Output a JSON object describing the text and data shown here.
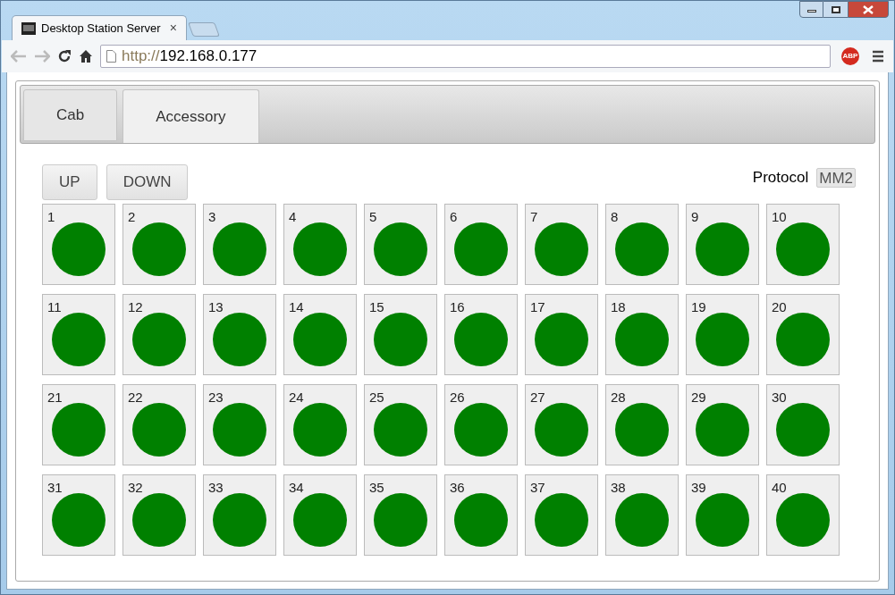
{
  "window": {
    "title": "Desktop Station Server",
    "close_tab": "×"
  },
  "address_bar": {
    "scheme": "http://",
    "host": "192.168.0.177"
  },
  "extension": {
    "label": "ABP"
  },
  "tabs": [
    {
      "label": "Cab",
      "selected": false
    },
    {
      "label": "Accessory",
      "selected": true
    }
  ],
  "buttons": [
    "UP",
    "DOWN"
  ],
  "protocol": {
    "label": "Protocol",
    "value": "MM2"
  },
  "accessories": [
    {
      "number": "1",
      "on": true
    },
    {
      "number": "2",
      "on": true
    },
    {
      "number": "3",
      "on": true
    },
    {
      "number": "4",
      "on": true
    },
    {
      "number": "5",
      "on": true
    },
    {
      "number": "6",
      "on": true
    },
    {
      "number": "7",
      "on": true
    },
    {
      "number": "8",
      "on": true
    },
    {
      "number": "9",
      "on": true
    },
    {
      "number": "10",
      "on": true
    },
    {
      "number": "11",
      "on": true
    },
    {
      "number": "12",
      "on": true
    },
    {
      "number": "13",
      "on": true
    },
    {
      "number": "14",
      "on": true
    },
    {
      "number": "15",
      "on": true
    },
    {
      "number": "16",
      "on": true
    },
    {
      "number": "17",
      "on": true
    },
    {
      "number": "18",
      "on": true
    },
    {
      "number": "19",
      "on": true
    },
    {
      "number": "20",
      "on": true
    },
    {
      "number": "21",
      "on": true
    },
    {
      "number": "22",
      "on": true
    },
    {
      "number": "23",
      "on": true
    },
    {
      "number": "24",
      "on": true
    },
    {
      "number": "25",
      "on": true
    },
    {
      "number": "26",
      "on": true
    },
    {
      "number": "27",
      "on": true
    },
    {
      "number": "28",
      "on": true
    },
    {
      "number": "29",
      "on": true
    },
    {
      "number": "30",
      "on": true
    },
    {
      "number": "31",
      "on": true
    },
    {
      "number": "32",
      "on": true
    },
    {
      "number": "33",
      "on": true
    },
    {
      "number": "34",
      "on": true
    },
    {
      "number": "35",
      "on": true
    },
    {
      "number": "36",
      "on": true
    },
    {
      "number": "37",
      "on": true
    },
    {
      "number": "38",
      "on": true
    },
    {
      "number": "39",
      "on": true
    },
    {
      "number": "40",
      "on": true
    }
  ]
}
